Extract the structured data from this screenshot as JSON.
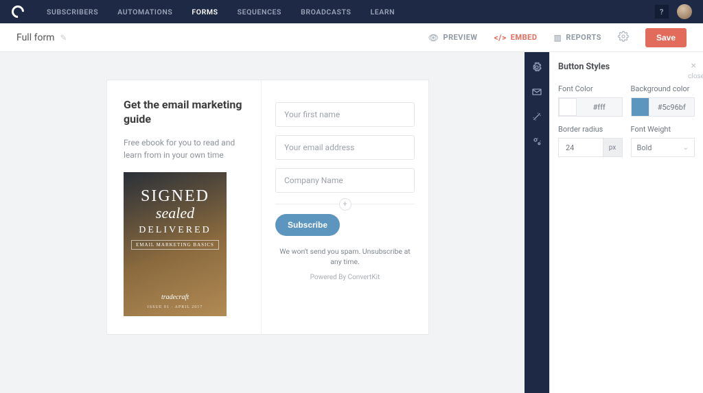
{
  "nav": {
    "items": [
      "Subscribers",
      "Automations",
      "Forms",
      "Sequences",
      "Broadcasts",
      "Learn"
    ],
    "active_index": 2,
    "help": "?"
  },
  "subbar": {
    "title": "Full form",
    "preview": "Preview",
    "embed": "Embed",
    "reports": "Reports",
    "save": "Save"
  },
  "form": {
    "heading": "Get the email marketing guide",
    "sub": "Free ebook for you to read and learn from in your own time",
    "cover": {
      "l1": "SIGNED",
      "l2": "sealed",
      "l3": "DELIVERED",
      "l4": "EMAIL MARKETING BASICS",
      "sig": "tradecraft",
      "date": "ISSUE 01 · APRIL 2017"
    },
    "fields": {
      "first_name": "Your first name",
      "email": "Your email address",
      "company": "Company Name"
    },
    "subscribe": "Subscribe",
    "spam": "We won't send you spam. Unsubscribe at any time.",
    "powered": "Powered By ConvertKit"
  },
  "panel": {
    "title": "Button Styles",
    "close_label": "close",
    "font_color": {
      "label": "Font Color",
      "value": "#fff",
      "swatch": "#ffffff"
    },
    "bg_color": {
      "label": "Background color",
      "value": "#5c96bf",
      "swatch": "#5c96bf"
    },
    "radius": {
      "label": "Border radius",
      "value": "24",
      "unit": "px"
    },
    "weight": {
      "label": "Font Weight",
      "value": "Bold"
    }
  }
}
